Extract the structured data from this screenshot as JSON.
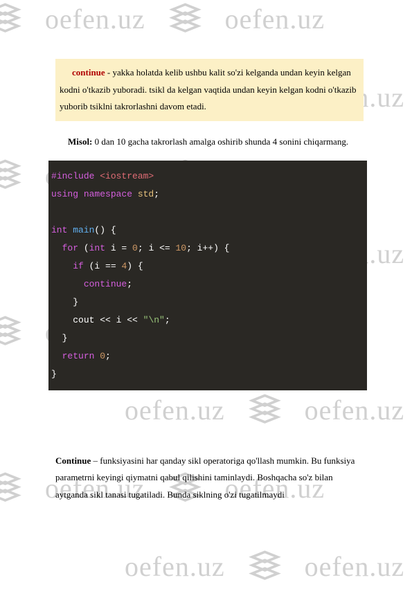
{
  "watermark": {
    "text": "oefen.uz"
  },
  "highlight": {
    "term": "continue",
    "text": " - yakka holatda kelib ushbu kalit so'zi kelganda undan keyin kelgan kodni o'tkazib yuboradi. tsikl da kelgan vaqtida undan keyin kelgan kodni o'tkazib yuborib tsiklni takrorlashni davom etadi."
  },
  "misol": {
    "label": "Misol:",
    "text": " 0 dan 10 gacha takrorlash amalga oshirib shunda 4 sonini chiqarmang."
  },
  "code": {
    "l1_hash": "#",
    "l1_include": "include",
    "l1_header": " <iostream>",
    "l2_using": "using",
    "l2_namespace": " namespace",
    "l2_std": " std",
    "l2_semi": ";",
    "l4_int": "int",
    "l4_main": " main",
    "l4_paren": "() {",
    "l5_indent": "  ",
    "l5_for": "for",
    "l5_p1": " (",
    "l5_int": "int",
    "l5_ieq": " i = ",
    "l5_zero": "0",
    "l5_semi1": "; i <= ",
    "l5_ten": "10",
    "l5_semi2": "; i++) {",
    "l6_indent": "    ",
    "l6_if": "if",
    "l6_p1": " (i == ",
    "l6_four": "4",
    "l6_p2": ") {",
    "l7_indent": "      ",
    "l7_continue": "continue",
    "l7_semi": ";",
    "l8_indent": "    ",
    "l8_brace": "}",
    "l9_indent": "    ",
    "l9_cout": "cout << i << ",
    "l9_str": "\"\\n\"",
    "l9_semi": ";",
    "l10_indent": "  ",
    "l10_brace": "}",
    "l11_indent": "  ",
    "l11_return": "return",
    "l11_sp": " ",
    "l11_zero": "0",
    "l11_semi": ";",
    "l12_brace": "}"
  },
  "bottom": {
    "bold": "Continue",
    "text": " – funksiyasini har qanday sikl operatoriga qo'llash mumkin. Bu funksiya parametrni keyingi qiymatni qabul qilishini taminlaydi. Boshqacha so'z bilan aytganda sikl tanasi tugatiladi. Bunda siklning o'zi tugatilmaydi"
  }
}
